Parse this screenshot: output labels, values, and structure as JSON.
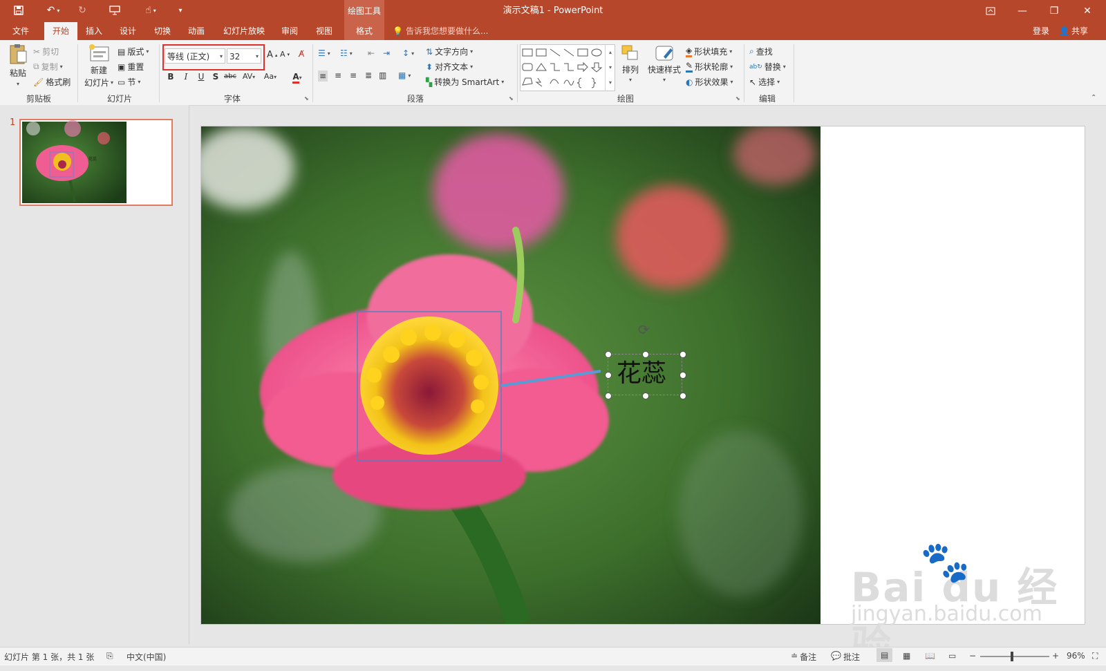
{
  "app": {
    "title": "演示文稿1 - PowerPoint",
    "contextual_header": "绘图工具"
  },
  "tabs": [
    "文件",
    "开始",
    "插入",
    "设计",
    "切换",
    "动画",
    "幻灯片放映",
    "审阅",
    "视图",
    "格式"
  ],
  "active_tab": "开始",
  "tell_me": "告诉我您想要做什么...",
  "account": {
    "signin": "登录",
    "share": "共享"
  },
  "clipboard": {
    "paste": "粘贴",
    "cut": "剪切",
    "copy": "复制",
    "format_painter": "格式刷",
    "label": "剪贴板"
  },
  "slides_group": {
    "new_slide_1": "新建",
    "new_slide_2": "幻灯片",
    "layout": "版式",
    "reset": "重置",
    "section": "节",
    "label": "幻灯片"
  },
  "font_group": {
    "font_name": "等线 (正文)",
    "font_size": "32",
    "label": "字体",
    "bold": "B",
    "italic": "I",
    "underline": "U",
    "shadow": "S",
    "strike": "abc",
    "spacing": "AV",
    "case": "Aa",
    "color": "A"
  },
  "paragraph_group": {
    "text_direction": "文字方向",
    "align_text": "对齐文本",
    "smartart": "转换为 SmartArt",
    "label": "段落"
  },
  "drawing_group": {
    "arrange": "排列",
    "quick_styles": "快速样式",
    "shape_fill": "形状填充",
    "shape_outline": "形状轮廓",
    "shape_effects": "形状效果",
    "label": "绘图"
  },
  "editing_group": {
    "find": "查找",
    "replace": "替换",
    "select": "选择",
    "label": "编辑"
  },
  "thumbnail": {
    "number": "1"
  },
  "slide": {
    "callout_text": "花蕊"
  },
  "status": {
    "slide_info": "幻灯片 第 1 张，共 1 张",
    "language": "中文(中国)",
    "notes": "备注",
    "comments": "批注",
    "zoom": "96%"
  },
  "watermark": {
    "brand": "Bai du 经验",
    "url": "jingyan.baidu.com"
  },
  "colors": {
    "accent": "#b7472a",
    "highlight_box": "#e0302a",
    "callout_line": "#5b9bd5"
  }
}
